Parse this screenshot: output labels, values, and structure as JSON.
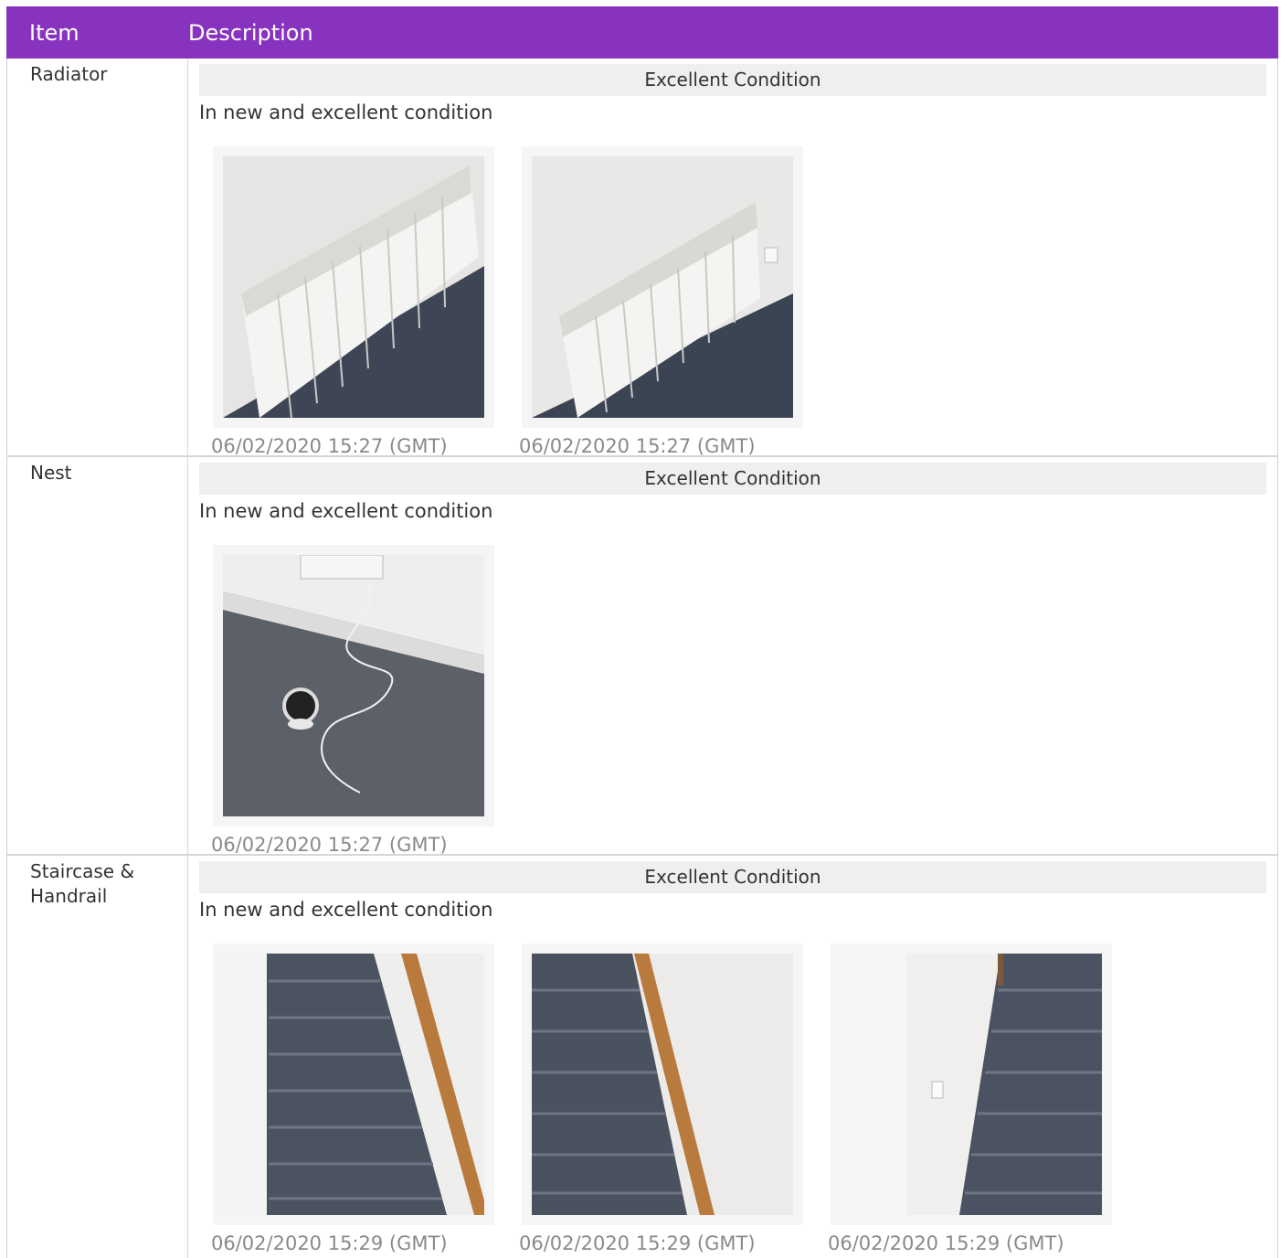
{
  "header": {
    "item": "Item",
    "description": "Description"
  },
  "rows": [
    {
      "item": "Radiator",
      "condition": "Excellent Condition",
      "description": "In new and excellent condition",
      "photos": [
        {
          "subject": "radiator photo",
          "timestamp": "06/02/2020 15:27 (GMT)"
        },
        {
          "subject": "radiator photo",
          "timestamp": "06/02/2020 15:27 (GMT)"
        }
      ]
    },
    {
      "item": "Nest",
      "condition": "Excellent Condition",
      "description": "In new and excellent condition",
      "photos": [
        {
          "subject": "nest camera photo",
          "timestamp": "06/02/2020 15:27 (GMT)"
        }
      ]
    },
    {
      "item": "Staircase & Handrail",
      "condition": "Excellent Condition",
      "description": "In new and excellent condition",
      "photos": [
        {
          "subject": "staircase photo",
          "timestamp": "06/02/2020 15:29 (GMT)"
        },
        {
          "subject": "staircase photo",
          "timestamp": "06/02/2020 15:29 (GMT)"
        },
        {
          "subject": "staircase photo",
          "timestamp": "06/02/2020 15:29 (GMT)"
        }
      ]
    }
  ],
  "colors": {
    "header_bg": "#8833c0",
    "condition_bg": "#efefef",
    "timestamp": "#8a8a8a"
  }
}
